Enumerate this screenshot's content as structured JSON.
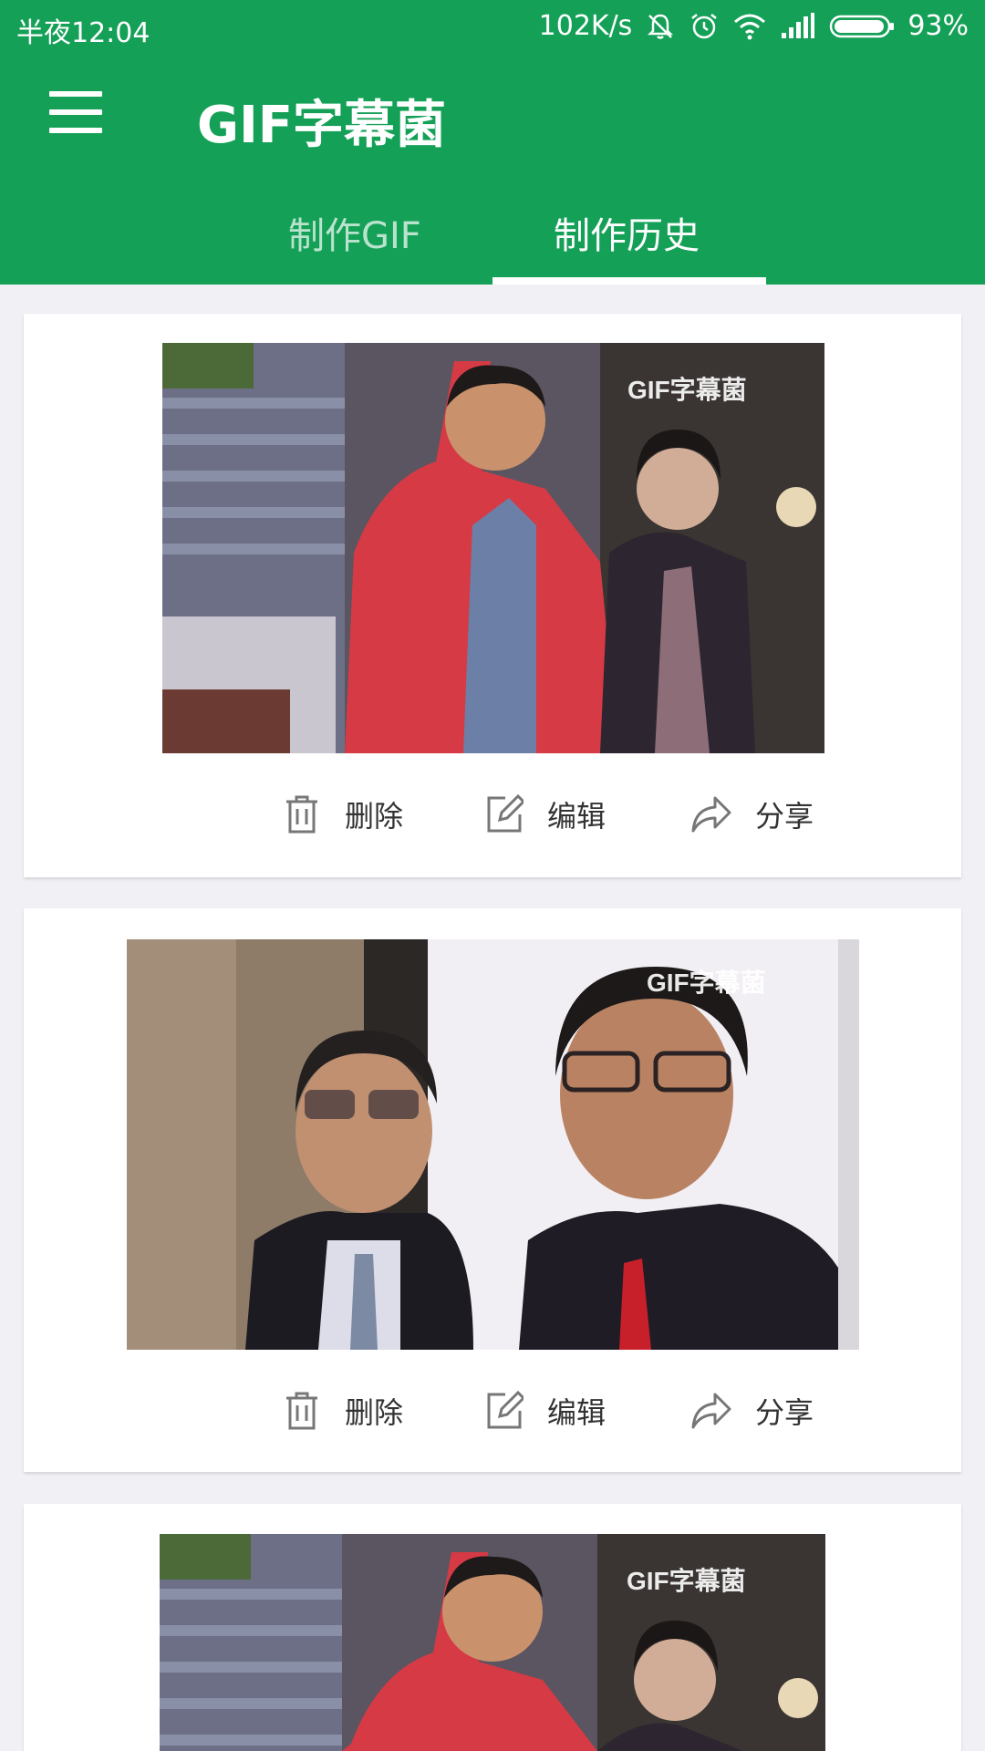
{
  "status_bar": {
    "time": "半夜12:04",
    "net_speed": "102K/s",
    "battery": "93%",
    "icons": [
      "mute-icon",
      "alarm-icon",
      "wifi-icon",
      "signal-icon",
      "battery-icon"
    ]
  },
  "app_bar": {
    "title": "GIF字幕菌",
    "menu_icon": "menu-icon"
  },
  "tabs": [
    {
      "label": "制作GIF",
      "selected": false
    },
    {
      "label": "制作历史",
      "selected": true
    }
  ],
  "history": [
    {
      "watermark": "GIF字幕菌",
      "actions": {
        "delete": "删除",
        "edit": "编辑",
        "share": "分享"
      }
    },
    {
      "watermark": "GIF字幕菌",
      "actions": {
        "delete": "删除",
        "edit": "编辑",
        "share": "分享"
      }
    },
    {
      "watermark": "GIF字幕菌"
    }
  ],
  "colors": {
    "primary": "#14a057",
    "background": "#f0f0f5",
    "card": "#ffffff",
    "text": "#333333",
    "icon": "#777777"
  }
}
